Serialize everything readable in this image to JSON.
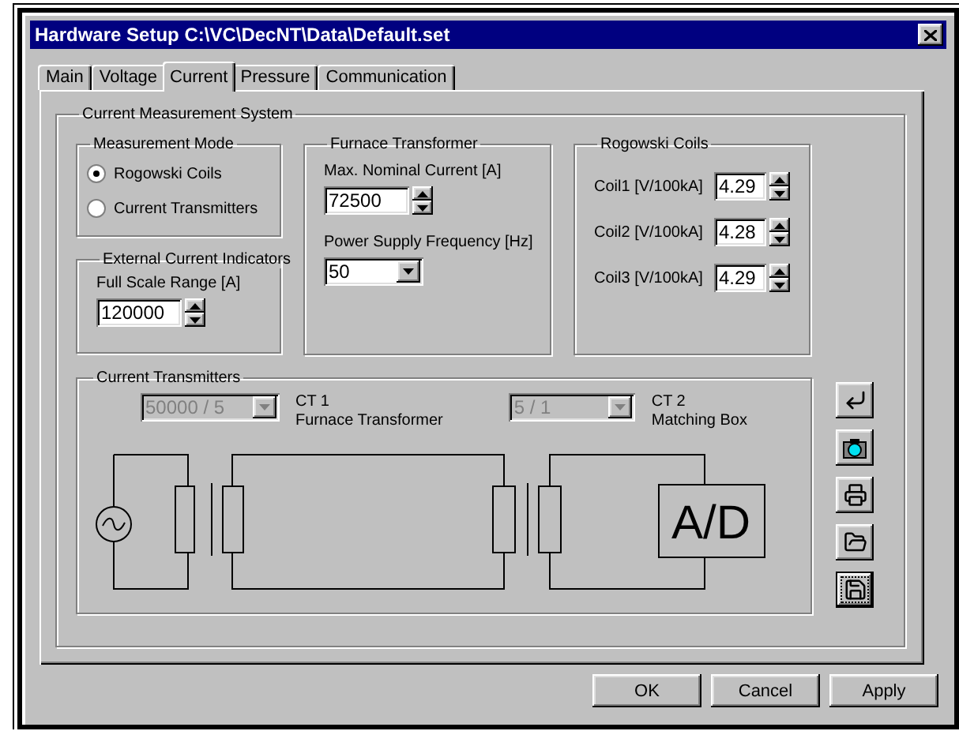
{
  "window": {
    "title": "Hardware Setup C:\\VC\\DecNT\\Data\\Default.set"
  },
  "tabs": [
    {
      "label": "Main",
      "selected": false
    },
    {
      "label": "Voltage",
      "selected": false
    },
    {
      "label": "Current",
      "selected": true
    },
    {
      "label": "Pressure",
      "selected": false
    },
    {
      "label": "Communication",
      "selected": false
    }
  ],
  "system": {
    "title": "Current Measurement System"
  },
  "measurement_mode": {
    "title": "Measurement Mode",
    "options": [
      {
        "label": "Rogowski Coils",
        "selected": true
      },
      {
        "label": "Current Transmitters",
        "selected": false
      }
    ]
  },
  "external_indicators": {
    "title": "External Current Indicators",
    "label": "Full Scale Range [A]",
    "value": "120000"
  },
  "furnace_transformer": {
    "title": "Furnace Transformer",
    "max_label": "Max. Nominal Current [A]",
    "max_value": "72500",
    "freq_label": "Power Supply Frequency [Hz]",
    "freq_value": "50"
  },
  "rogowski": {
    "title": "Rogowski Coils",
    "coils": [
      {
        "label": "Coil1 [V/100kA]",
        "value": "4.29"
      },
      {
        "label": "Coil2 [V/100kA]",
        "value": "4.28"
      },
      {
        "label": "Coil3 [V/100kA]",
        "value": "4.29"
      }
    ]
  },
  "transmitters": {
    "title": "Current Transmitters",
    "cts": [
      {
        "value": "50000 / 5",
        "name": "CT 1",
        "description": "Furnace Transformer",
        "disabled": true
      },
      {
        "value": "5 / 1",
        "name": "CT 2",
        "description": "Matching Box",
        "disabled": true
      }
    ],
    "converter": "A/D"
  },
  "side_buttons": [
    {
      "kind": "return",
      "focused": false
    },
    {
      "kind": "camera",
      "focused": false
    },
    {
      "kind": "print",
      "focused": false
    },
    {
      "kind": "open",
      "focused": false
    },
    {
      "kind": "save",
      "focused": true
    }
  ],
  "buttons": [
    {
      "label": "OK"
    },
    {
      "label": "Cancel"
    },
    {
      "label": "Apply"
    }
  ]
}
